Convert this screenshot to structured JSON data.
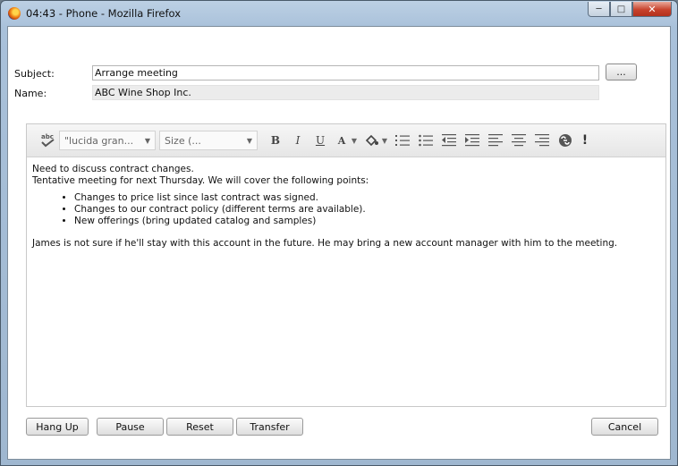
{
  "window": {
    "title": "04:43 - Phone - Mozilla Firefox"
  },
  "form": {
    "subject_label": "Subject:",
    "subject_value": "Arrange meeting",
    "name_label": "Name:",
    "name_value": "ABC Wine Shop Inc.",
    "lookup_button": "..."
  },
  "toolbar": {
    "spell_label": "abc",
    "font_select": "\"lucida gran...",
    "size_select": "Size (...",
    "bold": "B",
    "italic": "I",
    "underline": "U",
    "text_color": "A",
    "bg_color": "☀",
    "icons": [
      "spellcheck-icon",
      "font-family-select",
      "font-size-select",
      "bold-icon",
      "italic-icon",
      "underline-icon",
      "text-color-icon",
      "background-color-icon",
      "ordered-list-icon",
      "unordered-list-icon",
      "outdent-icon",
      "indent-icon",
      "align-left-icon",
      "align-center-icon",
      "align-right-icon",
      "link-icon",
      "important-icon"
    ]
  },
  "message": {
    "line1": "Need to discuss contract changes.",
    "line2": "Tentative meeting for next Thursday. We will cover the following points:",
    "bullets": [
      "Changes to price list since last contract was signed.",
      "Changes to our contract policy (different terms are available).",
      "New offerings (bring updated catalog and samples)"
    ],
    "closing": "James is not sure if he'll stay with this account in the future. He may bring a new account manager with him to the meeting."
  },
  "buttons": {
    "hang_up": "Hang Up",
    "pause": "Pause",
    "reset": "Reset",
    "transfer": "Transfer",
    "cancel": "Cancel"
  }
}
